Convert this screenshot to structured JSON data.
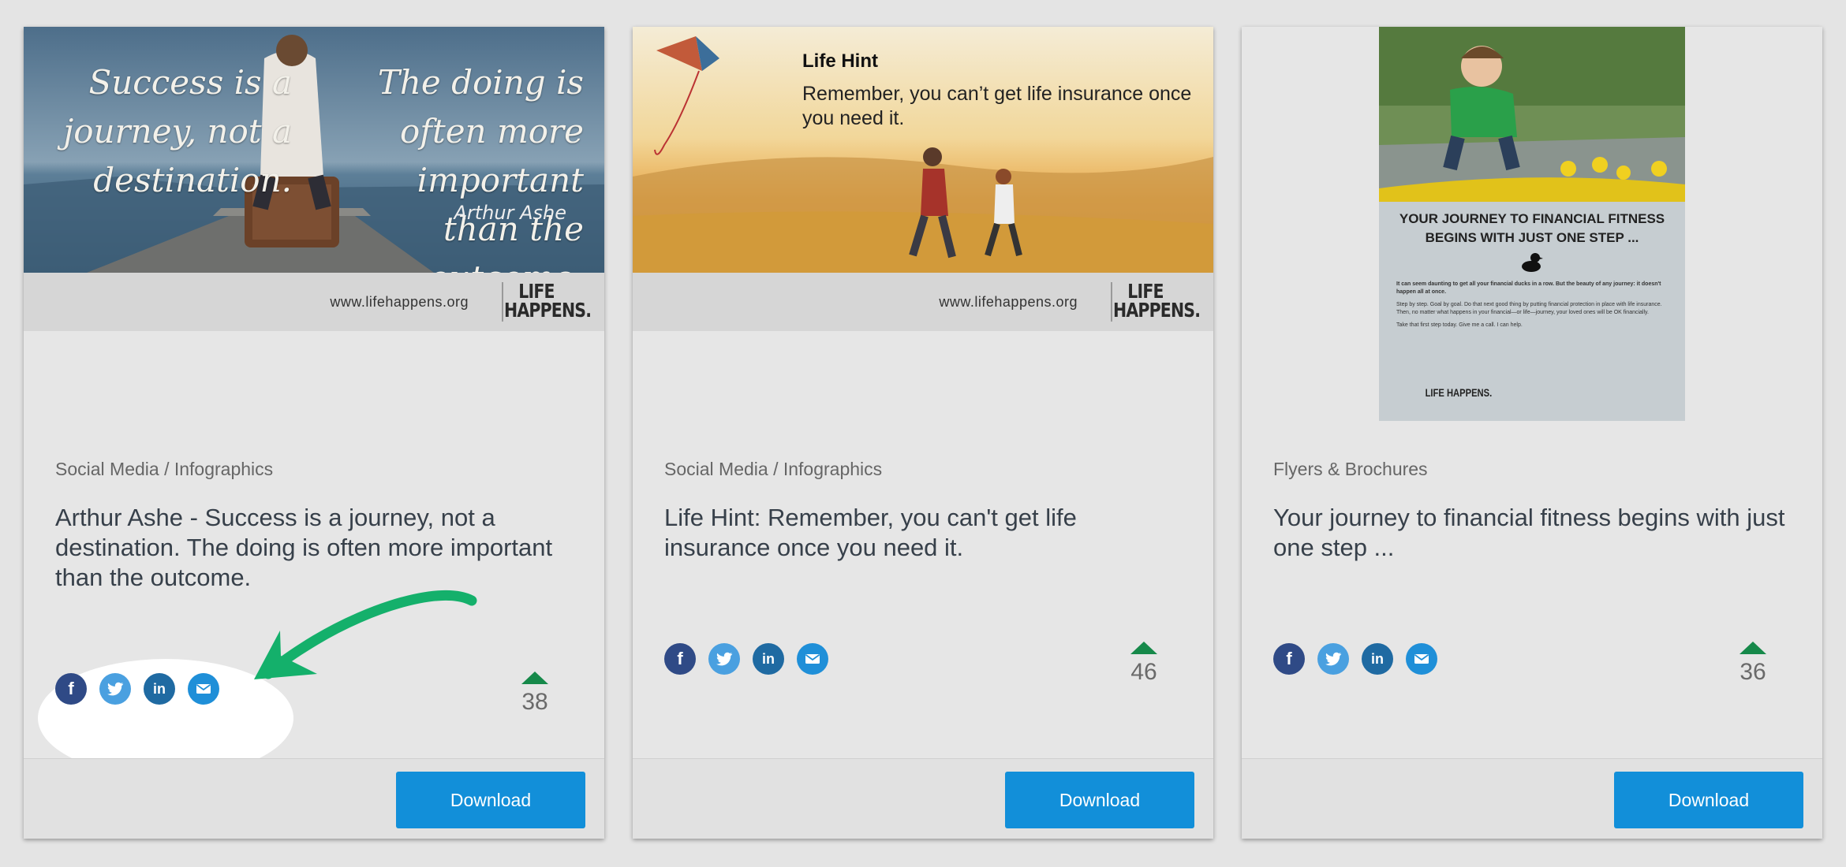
{
  "cards": [
    {
      "thumbnail": {
        "quote_left": "Success is a journey, not a destination.",
        "quote_right": "The doing is often more important than the outcome.",
        "quote_author": "Arthur Ashe",
        "brand_url": "www.lifehappens.org",
        "brand_logo": "LIFE HAPPENS."
      },
      "category": "Social Media / Infographics",
      "title": "Arthur Ashe - Success is a journey, not a destination. The doing is often more important than the outcome.",
      "votes": "38",
      "download_label": "Download"
    },
    {
      "thumbnail": {
        "hint_title": "Life Hint",
        "hint_text": "Remember, you can’t get life insurance once you need it.",
        "brand_url": "www.lifehappens.org",
        "brand_logo": "LIFE HAPPENS."
      },
      "category": "Social Media / Infographics",
      "title": "Life Hint: Remember, you can't get life insurance once you need it.",
      "votes": "46",
      "download_label": "Download"
    },
    {
      "thumbnail": {
        "poster_headline": "Your journey to financial fitness begins with just one step ...",
        "poster_lead": "It can seem daunting to get all your financial ducks in a row. But the beauty of any journey: it doesn't happen all at once.",
        "poster_body": "Step by step. Goal by goal. Do that next good thing by putting financial protection in place with life insurance. Then, no matter what happens in your financial—or life—journey, your loved ones will be OK financially.",
        "poster_cta": "Take that first step today. Give me a call. I can help.",
        "poster_logo": "LIFE HAPPENS."
      },
      "category": "Flyers & Brochures",
      "title": "Your journey to financial fitness begins with just one step ...",
      "votes": "36",
      "download_label": "Download"
    }
  ],
  "social_icons": [
    "facebook-icon",
    "twitter-icon",
    "linkedin-icon",
    "email-icon"
  ],
  "colors": {
    "download_button": "#128fd9",
    "vote_arrow": "#16894a",
    "annotation_arrow": "#14b06b",
    "facebook": "#2f4a86",
    "twitter": "#4aa0e0",
    "linkedin": "#1f6aa2",
    "email": "#1f8fd8"
  }
}
